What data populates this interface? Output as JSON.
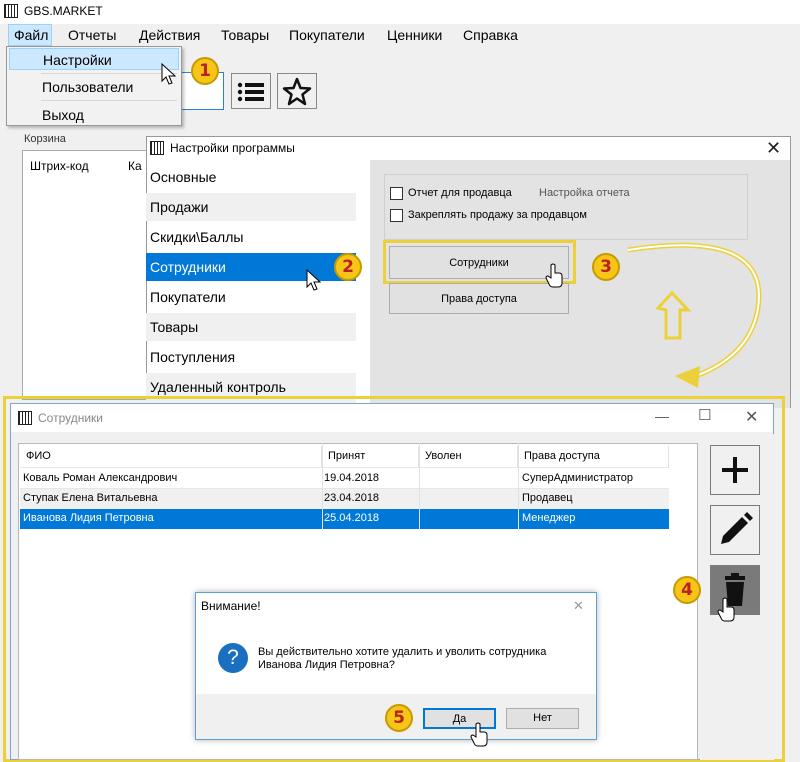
{
  "app": {
    "title": "GBS.MARKET"
  },
  "menu": [
    "Файл",
    "Отчеты",
    "Действия",
    "Товары",
    "Покупатели",
    "Ценники",
    "Справка"
  ],
  "file_menu": {
    "items": [
      "Настройки",
      "Пользователи",
      "Выход"
    ],
    "active": "Настройки"
  },
  "main": {
    "basket_label": "Корзина",
    "columns": [
      "Штрих-код",
      "Ка"
    ]
  },
  "settings_window": {
    "title": "Настройки программы",
    "nav": [
      "Основные",
      "Продажи",
      "Скидки\\Баллы",
      "Сотрудники",
      "Покупатели",
      "Товары",
      "Поступления",
      "Удаленный контроль"
    ],
    "active_nav": "Сотрудники",
    "options": {
      "report_for_seller": "Отчет для продавца",
      "report_settings": "Настройка отчета",
      "bind_sale": "Закреплять продажу за продавцом"
    },
    "buttons": {
      "employees": "Сотрудники",
      "access_rights": "Права доступа"
    }
  },
  "employees_window": {
    "title": "Сотрудники",
    "columns": [
      "ФИО",
      "Принят",
      "Уволен",
      "Права доступа"
    ],
    "rows": [
      {
        "name": "Коваль Роман Александрович",
        "hired": "19.04.2018",
        "fired": "",
        "role": "СуперАдминистратор"
      },
      {
        "name": "Ступак Елена Витальевна",
        "hired": "23.04.2018",
        "fired": "",
        "role": "Продавец"
      },
      {
        "name": "Иванова Лидия Петровна",
        "hired": "25.04.2018",
        "fired": "",
        "role": "Менеджер"
      }
    ],
    "selected_row": 2
  },
  "dialog": {
    "title": "Внимание!",
    "message_line1": "Вы действительно хотите удалить и  уволить  сотрудника",
    "message_line2": "Иванова Лидия Петровна?",
    "yes": "Да",
    "no": "Нет"
  },
  "callouts": [
    "1",
    "2",
    "3",
    "4",
    "5"
  ],
  "colors": {
    "accent": "#0078d7",
    "callout": "#f5c518",
    "highlight": "#ecd03a"
  }
}
